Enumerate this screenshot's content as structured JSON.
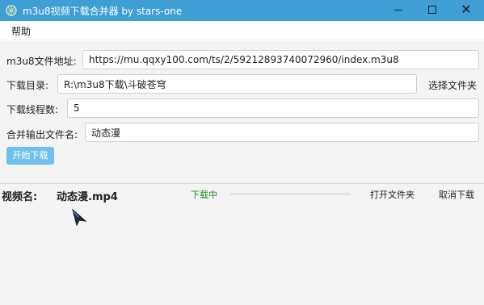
{
  "window": {
    "title": "m3u8视频下载合并器 by stars-one",
    "minimize_icon": "minimize-icon",
    "maximize_icon": "maximize-icon",
    "close_icon": "close-icon",
    "close_glyph": "✕"
  },
  "menu": {
    "help": "帮助"
  },
  "form": {
    "url_label": "m3u8文件地址:",
    "url_value": "https://mu.qqxy100.com/ts/2/59212893740072960/index.m3u8",
    "dir_label": "下载目录:",
    "dir_value": "R:\\m3u8下载\\斗破苍穹",
    "choose_folder": "选择文件夹",
    "threads_label": "下载线程数:",
    "threads_value": "5",
    "output_label": "合并输出文件名:",
    "output_value": "动态漫",
    "start_button": "开始下载"
  },
  "task": {
    "name_label": "视频名:",
    "file_name": "动态漫.mp4",
    "status": "下载中",
    "progress": 0,
    "open_folder": "打开文件夹",
    "cancel": "取消下载"
  },
  "colors": {
    "titlebar": "#3f9ed4",
    "start_button": "#70c0ee",
    "status_green": "#1f8a1f",
    "progress_fill": "#6ab7e8"
  }
}
